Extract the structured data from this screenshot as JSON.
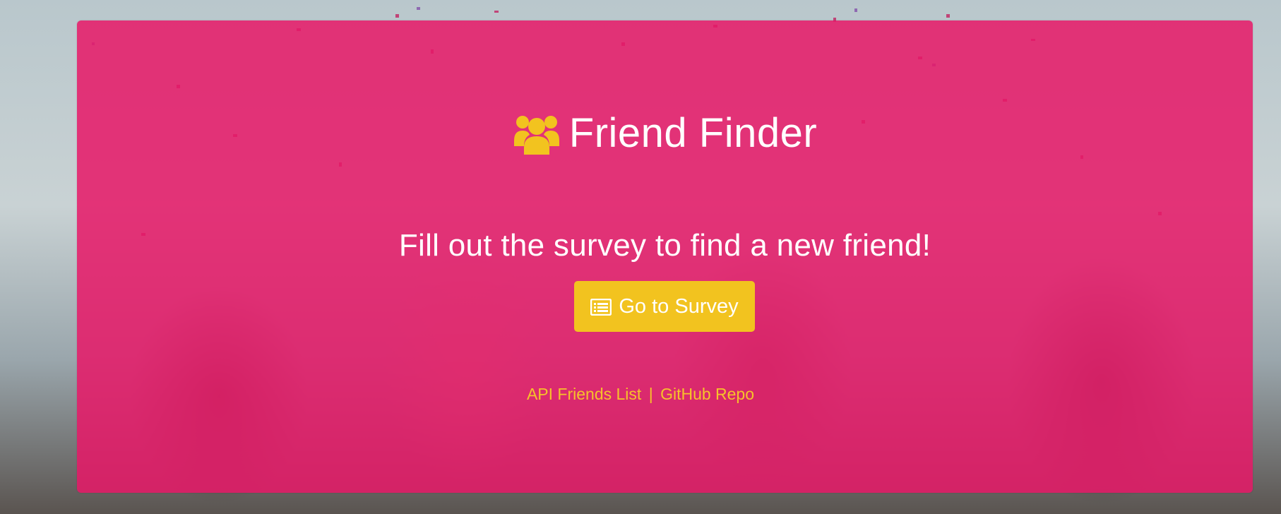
{
  "header": {
    "title": "Friend Finder",
    "icon": "users-icon"
  },
  "main": {
    "subtitle": "Fill out the survey to find a new friend!",
    "survey_button": {
      "label": "Go to Survey",
      "icon": "list-alt-icon"
    }
  },
  "footer_links": {
    "api_label": "API Friends List",
    "separator": "|",
    "github_label": "GitHub Repo"
  },
  "colors": {
    "panel_overlay": "#e61868",
    "accent_yellow": "#f2c31f",
    "text_white": "#ffffff"
  }
}
